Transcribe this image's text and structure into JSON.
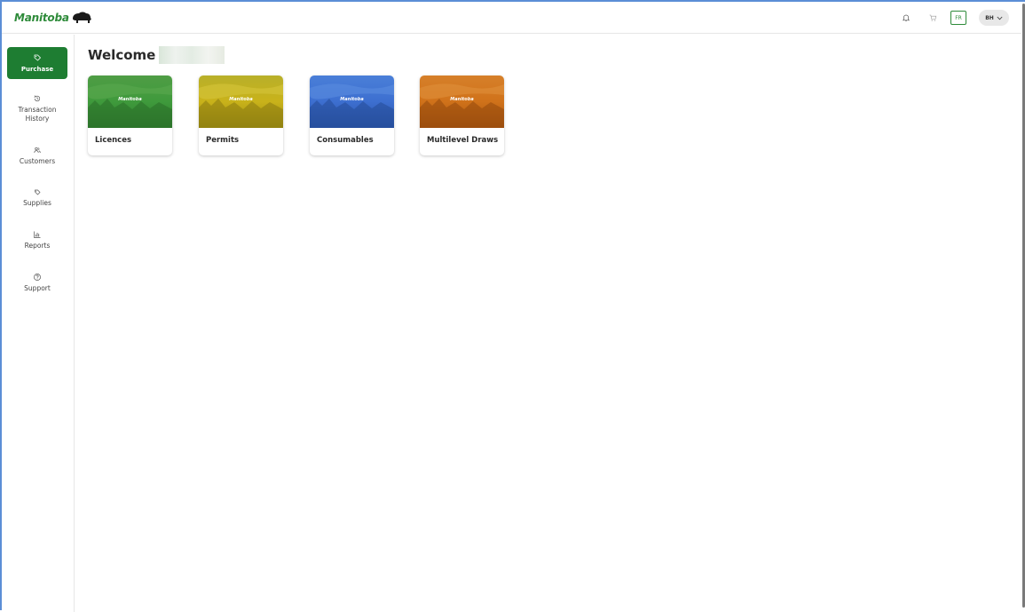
{
  "header": {
    "logo_text": "Manitoba",
    "lang_label": "FR",
    "user_initials": "BH",
    "icons": [
      "bell-icon",
      "cart-icon",
      "chevron-down-icon"
    ]
  },
  "sidebar": {
    "items": [
      {
        "label": "Purchase",
        "icon": "tag-icon",
        "active": true
      },
      {
        "label": "Transaction History",
        "icon": "history-icon",
        "active": false
      },
      {
        "label": "Customers",
        "icon": "users-icon",
        "active": false
      },
      {
        "label": "Supplies",
        "icon": "supplies-icon",
        "active": false
      },
      {
        "label": "Reports",
        "icon": "chart-icon",
        "active": false
      },
      {
        "label": "Support",
        "icon": "help-icon",
        "active": false
      }
    ]
  },
  "main": {
    "welcome": "Welcome",
    "cards": [
      {
        "label": "Licences",
        "brand": "Manitoba",
        "color": "#3f9a3c"
      },
      {
        "label": "Permits",
        "brand": "Manitoba",
        "color": "#c9b21a"
      },
      {
        "label": "Consumables",
        "brand": "Manitoba",
        "color": "#3d6fd0"
      },
      {
        "label": "Multilevel Draws",
        "brand": "Manitoba",
        "color": "#d0721a"
      }
    ]
  },
  "colors": {
    "brand_green": "#2e8b3a",
    "active_nav": "#1e7d32",
    "frame_blue": "#5b8ed6"
  }
}
